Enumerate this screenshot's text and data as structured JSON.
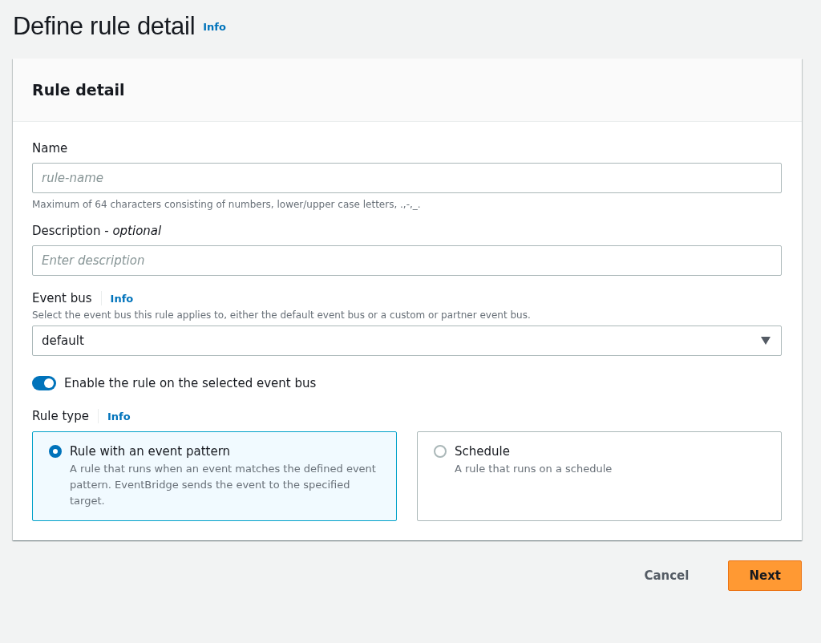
{
  "page": {
    "title": "Define rule detail",
    "info_link": "Info"
  },
  "panel": {
    "title": "Rule detail",
    "name_field": {
      "label": "Name",
      "placeholder": "rule-name",
      "hint": "Maximum of 64 characters consisting of numbers, lower/upper case letters, .,-,_."
    },
    "description_field": {
      "label": "Description - *optional*",
      "placeholder": "Enter description"
    },
    "event_bus": {
      "label": "Event bus",
      "info_link": "Info",
      "description": "Select the event bus this rule applies to, either the default event bus or a custom or partner event bus.",
      "value": "default"
    },
    "enable_toggle": {
      "label": "Enable the rule on the selected event bus",
      "on": true
    },
    "rule_type": {
      "label": "Rule type",
      "info_link": "Info",
      "options": [
        {
          "title": "Rule with an event pattern",
          "description": "A rule that runs when an event matches the defined event pattern. EventBridge sends the event to the specified target.",
          "selected": true
        },
        {
          "title": "Schedule",
          "description": "A rule that runs on a schedule",
          "selected": false
        }
      ]
    }
  },
  "buttons": [
    {
      "label": "Cancel",
      "kind": "link"
    },
    {
      "label": "Next",
      "kind": "primary"
    }
  ]
}
